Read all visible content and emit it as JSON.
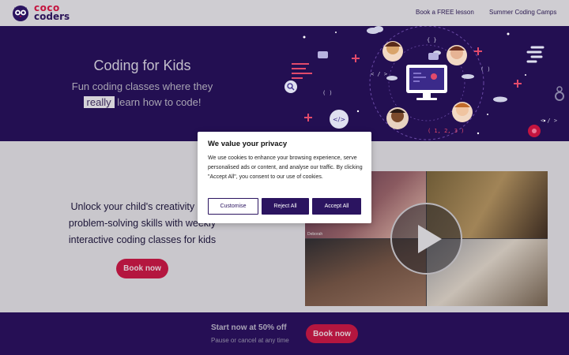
{
  "brand": {
    "line1": "coco",
    "line2": "coders"
  },
  "nav": {
    "free_lesson": "Book a FREE lesson",
    "camps": "Summer Coding Camps"
  },
  "hero": {
    "title": "Coding for Kids",
    "subtitle_line1": "Fun coding classes where they",
    "subtitle_highlight": "really",
    "subtitle_line2_rest": "learn how to code!",
    "illustration_labels": [
      "< / >",
      "( )",
      "{ }",
      "< / >",
      "( 1, 2, 3 )",
      "( )"
    ]
  },
  "main": {
    "tagline": "Unlock your child's creativity and problem-solving skills with weekly interactive coding classes for kids",
    "book_button": "Book now",
    "video_participant": "Deborah"
  },
  "cookie": {
    "title": "We value your privacy",
    "body": "We use cookies to enhance your browsing experience, serve personalised ads or content, and analyse our traffic. By clicking \"Accept All\", you consent to our use of cookies.",
    "customise": "Customise",
    "reject": "Reject All",
    "accept": "Accept All"
  },
  "promo": {
    "title": "Start now at 50% off",
    "subtitle": "Pause or cancel at any time",
    "button": "Book now"
  },
  "colors": {
    "brand_purple": "#2b1460",
    "brand_red": "#c4143f",
    "hero_bg": "#230f52"
  }
}
